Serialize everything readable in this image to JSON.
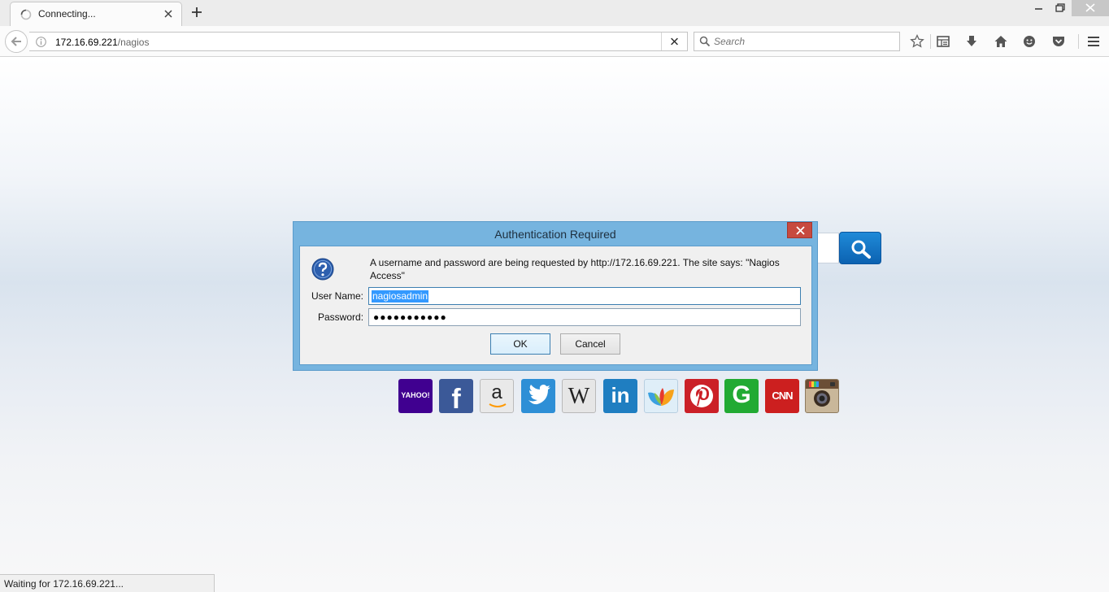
{
  "tab": {
    "title": "Connecting...",
    "icon": "loading-spinner-icon"
  },
  "address": {
    "host": "172.16.69.221",
    "path": "/nagios"
  },
  "search": {
    "placeholder": "Search"
  },
  "toolbar": {
    "icons": [
      "bookmark-star-icon",
      "reading-list-icon",
      "download-arrow-icon",
      "home-icon",
      "hello-chat-icon",
      "pocket-icon",
      "hamburger-menu-icon"
    ]
  },
  "dialog": {
    "title": "Authentication Required",
    "message": "A username and password are being requested by http://172.16.69.221. The site says: \"Nagios Access\"",
    "username_label": "User Name:",
    "username_value": "nagiosadmin",
    "password_label": "Password:",
    "password_mask": "●●●●●●●●●●●",
    "ok_label": "OK",
    "cancel_label": "Cancel"
  },
  "quick_sites": [
    {
      "name": "yahoo",
      "text": "YAHOO!",
      "color": "#400090"
    },
    {
      "name": "facebook",
      "text": "f",
      "color": "#3b5998"
    },
    {
      "name": "amazon",
      "text": "a",
      "color": "#e9e9e9"
    },
    {
      "name": "twitter",
      "text": "",
      "color": "#2e8fd6"
    },
    {
      "name": "wikipedia",
      "text": "W",
      "color": "#e6e6e6"
    },
    {
      "name": "linkedin",
      "text": "in",
      "color": "#1f7ec1"
    },
    {
      "name": "msn",
      "text": "",
      "color": "#dfeef8"
    },
    {
      "name": "pinterest",
      "text": "P",
      "color": "#cb2027"
    },
    {
      "name": "google",
      "text": "G",
      "color": "#22aa33"
    },
    {
      "name": "cnn",
      "text": "CNN",
      "color": "#cc1f1f"
    },
    {
      "name": "instagram",
      "text": "",
      "color": "#c9b79a"
    }
  ],
  "status": {
    "text": "Waiting for 172.16.69.221..."
  }
}
